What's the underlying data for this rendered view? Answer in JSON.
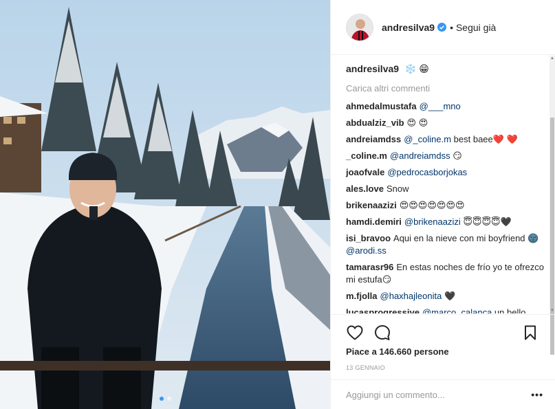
{
  "post": {
    "author": "andresilva9",
    "follow_status": "Segui già",
    "separator": "•",
    "carousel": {
      "count": 2,
      "active_index": 0
    }
  },
  "caption": {
    "user": "andresilva9",
    "text": "❄️ 😁"
  },
  "load_more_label": "Carica altri commenti",
  "comments": [
    {
      "user": "ahmedalmustafa",
      "mention": "@___mno",
      "text": ""
    },
    {
      "user": "abdualziz_vib",
      "mention": "",
      "text": "😍 😍"
    },
    {
      "user": "andreiamdss",
      "mention": "@_coline.m",
      "text": " best baee❤️ ❤️"
    },
    {
      "user": "_coline.m",
      "mention": "@andreiamdss",
      "text": " 😏"
    },
    {
      "user": "joaofvale",
      "mention": "@pedrocasborjokas",
      "text": ""
    },
    {
      "user": "ales.love",
      "mention": "",
      "text": "Snow"
    },
    {
      "user": "brikenaazizi",
      "mention": "",
      "text": "😍😍😍😍😍😍😍"
    },
    {
      "user": "hamdi.demiri",
      "mention": "@brikenaazizi",
      "text": " 😇😇😇😇🖤"
    },
    {
      "user": "isi_bravoo",
      "text_before": "Aqui en la nieve con mi boyfriend 🌚 ",
      "mention": "@arodi.ss"
    },
    {
      "user": "tamarasr96",
      "mention": "",
      "text": "En estas noches de frío yo te ofrezco mi estufa😏"
    },
    {
      "user": "m.fjolla",
      "mention": "@haxhajleonita",
      "text": " 🖤"
    },
    {
      "user": "lucasprogressive",
      "mention": "@marco_calanca",
      "text": " un bello"
    }
  ],
  "likes_text": "Piace a 146.660 persone",
  "date_text": "13 GENNAIO",
  "comment_input": {
    "placeholder": "Aggiungi un commento..."
  },
  "more_options": "•••",
  "icons": {
    "like": "heart-icon",
    "comment": "comment-icon",
    "save": "bookmark-icon",
    "verified": "verified-badge-icon"
  },
  "colors": {
    "verified": "#3897f0",
    "mention": "#003569",
    "muted": "#999999",
    "text": "#262626"
  }
}
